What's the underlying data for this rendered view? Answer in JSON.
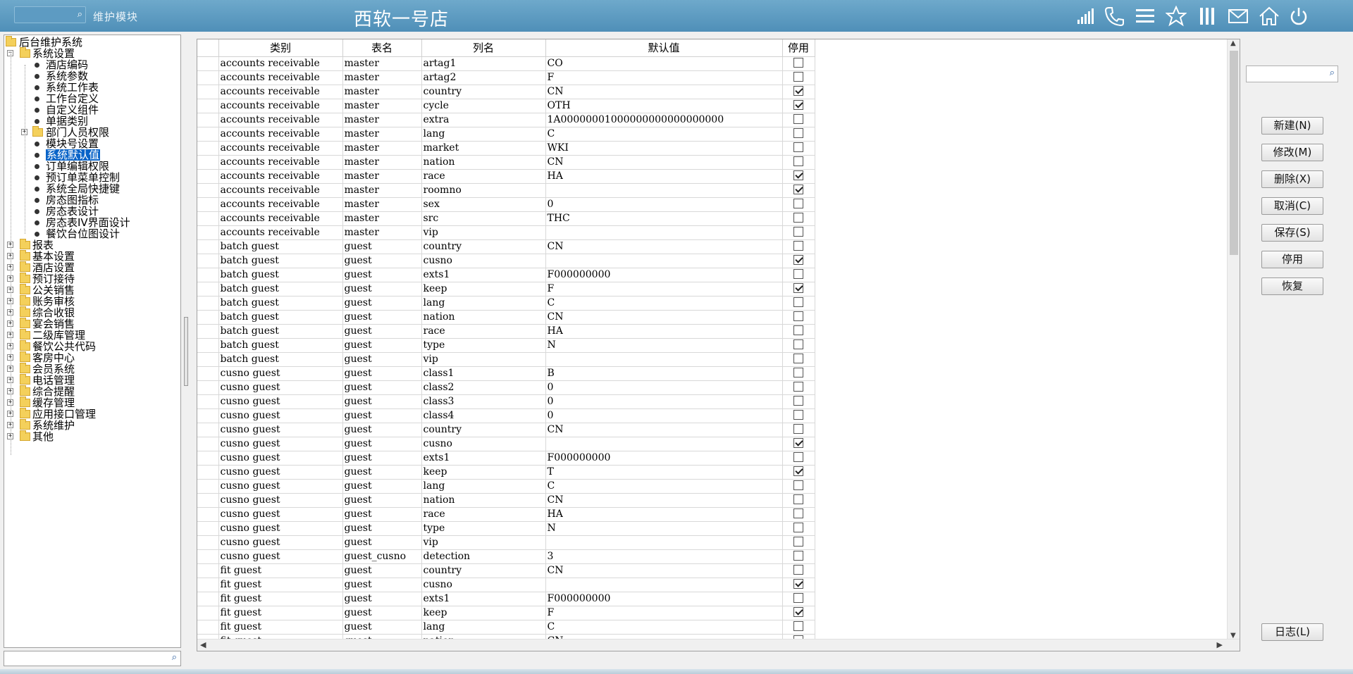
{
  "header": {
    "search_placeholder": "",
    "module_label": "维护模块",
    "store_title": "西软一号店",
    "icons": [
      "signal-icon",
      "phone-icon",
      "menu-icon",
      "star-icon",
      "columns-icon",
      "mail-icon",
      "home-icon",
      "power-icon"
    ]
  },
  "tree": {
    "nodes": [
      {
        "label": "后台维护系统",
        "level": 0,
        "type": "folder",
        "toggle": ""
      },
      {
        "label": "系统设置",
        "level": 1,
        "type": "folder",
        "toggle": "-"
      },
      {
        "label": "酒店编码",
        "level": 2,
        "type": "leaf"
      },
      {
        "label": "系统参数",
        "level": 2,
        "type": "leaf"
      },
      {
        "label": "系统工作表",
        "level": 2,
        "type": "leaf"
      },
      {
        "label": "工作台定义",
        "level": 2,
        "type": "leaf"
      },
      {
        "label": "自定义组件",
        "level": 2,
        "type": "leaf"
      },
      {
        "label": "单据类别",
        "level": 2,
        "type": "leaf"
      },
      {
        "label": "部门人员权限",
        "level": 2,
        "type": "folder",
        "toggle": "+"
      },
      {
        "label": "模块号设置",
        "level": 2,
        "type": "leaf"
      },
      {
        "label": "系统默认值",
        "level": 2,
        "type": "leaf",
        "selected": true
      },
      {
        "label": "订单编辑权限",
        "level": 2,
        "type": "leaf"
      },
      {
        "label": "预订单菜单控制",
        "level": 2,
        "type": "leaf"
      },
      {
        "label": "系统全局快捷键",
        "level": 2,
        "type": "leaf"
      },
      {
        "label": "房态图指标",
        "level": 2,
        "type": "leaf"
      },
      {
        "label": "房态表设计",
        "level": 2,
        "type": "leaf"
      },
      {
        "label": "房态表IV界面设计",
        "level": 2,
        "type": "leaf"
      },
      {
        "label": "餐饮台位图设计",
        "level": 2,
        "type": "leaf"
      },
      {
        "label": "报表",
        "level": 1,
        "type": "folder",
        "toggle": "+"
      },
      {
        "label": "基本设置",
        "level": 1,
        "type": "folder",
        "toggle": "+"
      },
      {
        "label": "酒店设置",
        "level": 1,
        "type": "folder",
        "toggle": "+"
      },
      {
        "label": "预订接待",
        "level": 1,
        "type": "folder",
        "toggle": "+"
      },
      {
        "label": "公关销售",
        "level": 1,
        "type": "folder",
        "toggle": "+"
      },
      {
        "label": "账务审核",
        "level": 1,
        "type": "folder",
        "toggle": "+"
      },
      {
        "label": "综合收银",
        "level": 1,
        "type": "folder",
        "toggle": "+"
      },
      {
        "label": "宴会销售",
        "level": 1,
        "type": "folder",
        "toggle": "+"
      },
      {
        "label": "二级库管理",
        "level": 1,
        "type": "folder",
        "toggle": "+"
      },
      {
        "label": "餐饮公共代码",
        "level": 1,
        "type": "folder",
        "toggle": "+"
      },
      {
        "label": "客房中心",
        "level": 1,
        "type": "folder",
        "toggle": "+"
      },
      {
        "label": "会员系统",
        "level": 1,
        "type": "folder",
        "toggle": "+"
      },
      {
        "label": "电话管理",
        "level": 1,
        "type": "folder",
        "toggle": "+"
      },
      {
        "label": "综合提醒",
        "level": 1,
        "type": "folder",
        "toggle": "+"
      },
      {
        "label": "缓存管理",
        "level": 1,
        "type": "folder",
        "toggle": "+"
      },
      {
        "label": "应用接口管理",
        "level": 1,
        "type": "folder",
        "toggle": "+"
      },
      {
        "label": "系统维护",
        "level": 1,
        "type": "folder",
        "toggle": "+"
      },
      {
        "label": "其他",
        "level": 1,
        "type": "folder",
        "toggle": "+"
      }
    ],
    "search_placeholder": ""
  },
  "grid": {
    "columns": [
      "类别",
      "表名",
      "列名",
      "默认值",
      "停用"
    ],
    "rows": [
      [
        "accounts receivable",
        "master",
        "artag1",
        "CO",
        false
      ],
      [
        "accounts receivable",
        "master",
        "artag2",
        "F",
        false
      ],
      [
        "accounts receivable",
        "master",
        "country",
        "CN",
        true
      ],
      [
        "accounts receivable",
        "master",
        "cycle",
        "OTH",
        true
      ],
      [
        "accounts receivable",
        "master",
        "extra",
        "1A00000001000000000000000000",
        false
      ],
      [
        "accounts receivable",
        "master",
        "lang",
        "C",
        false
      ],
      [
        "accounts receivable",
        "master",
        "market",
        "WKI",
        false
      ],
      [
        "accounts receivable",
        "master",
        "nation",
        "CN",
        false
      ],
      [
        "accounts receivable",
        "master",
        "race",
        "HA",
        true
      ],
      [
        "accounts receivable",
        "master",
        "roomno",
        "",
        true
      ],
      [
        "accounts receivable",
        "master",
        "sex",
        "0",
        false
      ],
      [
        "accounts receivable",
        "master",
        "src",
        "THC",
        false
      ],
      [
        "accounts receivable",
        "master",
        "vip",
        "",
        false
      ],
      [
        "batch guest",
        "guest",
        "country",
        "CN",
        false
      ],
      [
        "batch guest",
        "guest",
        "cusno",
        "",
        true
      ],
      [
        "batch guest",
        "guest",
        "exts1",
        "F000000000",
        false
      ],
      [
        "batch guest",
        "guest",
        "keep",
        "F",
        true
      ],
      [
        "batch guest",
        "guest",
        "lang",
        "C",
        false
      ],
      [
        "batch guest",
        "guest",
        "nation",
        "CN",
        false
      ],
      [
        "batch guest",
        "guest",
        "race",
        "HA",
        false
      ],
      [
        "batch guest",
        "guest",
        "type",
        "N",
        false
      ],
      [
        "batch guest",
        "guest",
        "vip",
        "",
        false
      ],
      [
        "cusno guest",
        "guest",
        "class1",
        "B",
        false
      ],
      [
        "cusno guest",
        "guest",
        "class2",
        "0",
        false
      ],
      [
        "cusno guest",
        "guest",
        "class3",
        "0",
        false
      ],
      [
        "cusno guest",
        "guest",
        "class4",
        "0",
        false
      ],
      [
        "cusno guest",
        "guest",
        "country",
        "CN",
        false
      ],
      [
        "cusno guest",
        "guest",
        "cusno",
        "",
        true
      ],
      [
        "cusno guest",
        "guest",
        "exts1",
        "F000000000",
        false
      ],
      [
        "cusno guest",
        "guest",
        "keep",
        "T",
        true
      ],
      [
        "cusno guest",
        "guest",
        "lang",
        "C",
        false
      ],
      [
        "cusno guest",
        "guest",
        "nation",
        "CN",
        false
      ],
      [
        "cusno guest",
        "guest",
        "race",
        "HA",
        false
      ],
      [
        "cusno guest",
        "guest",
        "type",
        "N",
        false
      ],
      [
        "cusno guest",
        "guest",
        "vip",
        "",
        false
      ],
      [
        "cusno guest",
        "guest_cusno",
        "detection",
        "3",
        false
      ],
      [
        "fit guest",
        "guest",
        "country",
        "CN",
        false
      ],
      [
        "fit guest",
        "guest",
        "cusno",
        "",
        true
      ],
      [
        "fit guest",
        "guest",
        "exts1",
        "F000000000",
        false
      ],
      [
        "fit guest",
        "guest",
        "keep",
        "F",
        true
      ],
      [
        "fit guest",
        "guest",
        "lang",
        "C",
        false
      ],
      [
        "fit guest",
        "guest",
        "nation",
        "CN",
        false
      ]
    ]
  },
  "right_panel": {
    "search_placeholder": "",
    "buttons": [
      {
        "name": "new-button",
        "label": "新建(N)"
      },
      {
        "name": "modify-button",
        "label": "修改(M)"
      },
      {
        "name": "delete-button",
        "label": "删除(X)"
      },
      {
        "name": "cancel-button",
        "label": "取消(C)"
      },
      {
        "name": "save-button",
        "label": "保存(S)"
      },
      {
        "name": "disable-button",
        "label": "停用"
      },
      {
        "name": "restore-button",
        "label": "恢复"
      }
    ],
    "log_button": "日志(L)"
  }
}
